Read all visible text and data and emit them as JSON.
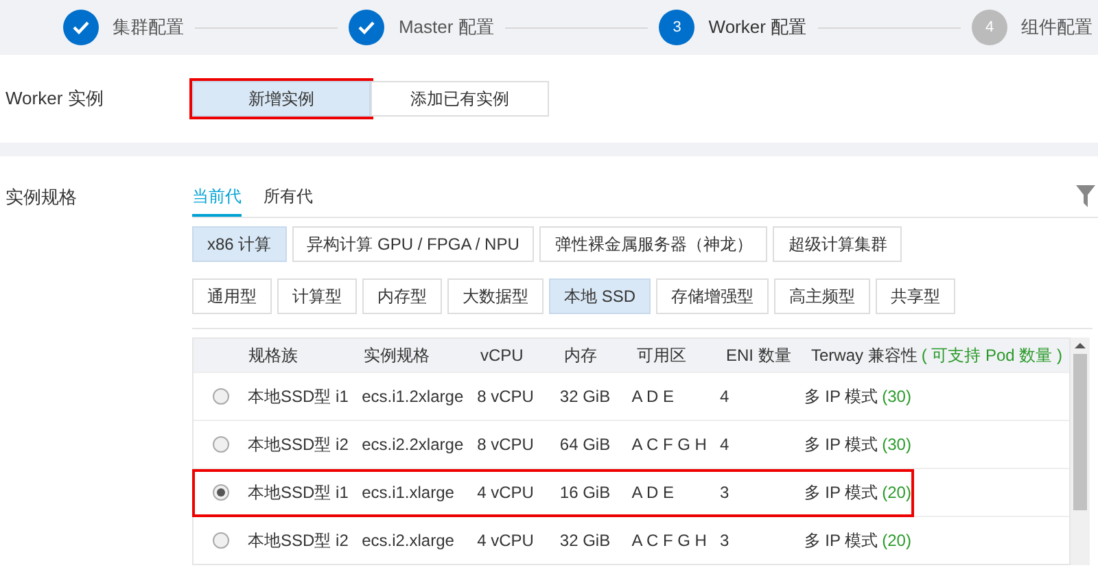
{
  "steps": [
    {
      "label": "集群配置",
      "done": true
    },
    {
      "label": "Master 配置",
      "done": true
    },
    {
      "number": "3",
      "label": "Worker 配置",
      "done": false,
      "selected": true
    },
    {
      "number": "4",
      "label": "组件配置",
      "done": false,
      "selected": false
    }
  ],
  "worker_instance": {
    "label": "Worker 实例",
    "options": [
      {
        "label": "新增实例",
        "selected": true,
        "highlighted": true
      },
      {
        "label": "添加已有实例",
        "selected": false,
        "highlighted": false
      }
    ]
  },
  "instance_spec": {
    "label": "实例规格",
    "generation_tabs": [
      {
        "label": "当前代",
        "selected": true
      },
      {
        "label": "所有代",
        "selected": false
      }
    ],
    "architectures": [
      {
        "label": "x86 计算",
        "selected": true
      },
      {
        "label": "异构计算 GPU / FPGA / NPU",
        "selected": false
      },
      {
        "label": "弹性裸金属服务器（神龙）",
        "selected": false
      },
      {
        "label": "超级计算集群",
        "selected": false
      }
    ],
    "categories": [
      {
        "label": "通用型",
        "selected": false
      },
      {
        "label": "计算型",
        "selected": false
      },
      {
        "label": "内存型",
        "selected": false
      },
      {
        "label": "大数据型",
        "selected": false
      },
      {
        "label": "本地 SSD",
        "selected": true
      },
      {
        "label": "存储增强型",
        "selected": false
      },
      {
        "label": "高主频型",
        "selected": false
      },
      {
        "label": "共享型",
        "selected": false
      }
    ],
    "table": {
      "columns": [
        "规格族",
        "实例规格",
        "vCPU",
        "内存",
        "可用区",
        "ENI 数量"
      ],
      "terway_column": {
        "label": "Terway 兼容性",
        "note": "( 可支持 Pod 数量 )"
      },
      "rows": [
        {
          "family": "本地SSD型 i1",
          "spec": "ecs.i1.2xlarge",
          "vcpu": "8 vCPU",
          "memory": "32 GiB",
          "zones": "A D E",
          "eni": "4",
          "mode": "多 IP 模式",
          "pods": "(30)",
          "selected": false,
          "highlighted": false
        },
        {
          "family": "本地SSD型 i2",
          "spec": "ecs.i2.2xlarge",
          "vcpu": "8 vCPU",
          "memory": "64 GiB",
          "zones": "A C F G H",
          "eni": "4",
          "mode": "多 IP 模式",
          "pods": "(30)",
          "selected": false,
          "highlighted": false
        },
        {
          "family": "本地SSD型 i1",
          "spec": "ecs.i1.xlarge",
          "vcpu": "4 vCPU",
          "memory": "16 GiB",
          "zones": "A D E",
          "eni": "3",
          "mode": "多 IP 模式",
          "pods": "(20)",
          "selected": true,
          "highlighted": true
        },
        {
          "family": "本地SSD型 i2",
          "spec": "ecs.i2.xlarge",
          "vcpu": "4 vCPU",
          "memory": "32 GiB",
          "zones": "A C F G H",
          "eni": "3",
          "mode": "多 IP 模式",
          "pods": "(20)",
          "selected": false,
          "highlighted": false
        }
      ]
    }
  }
}
